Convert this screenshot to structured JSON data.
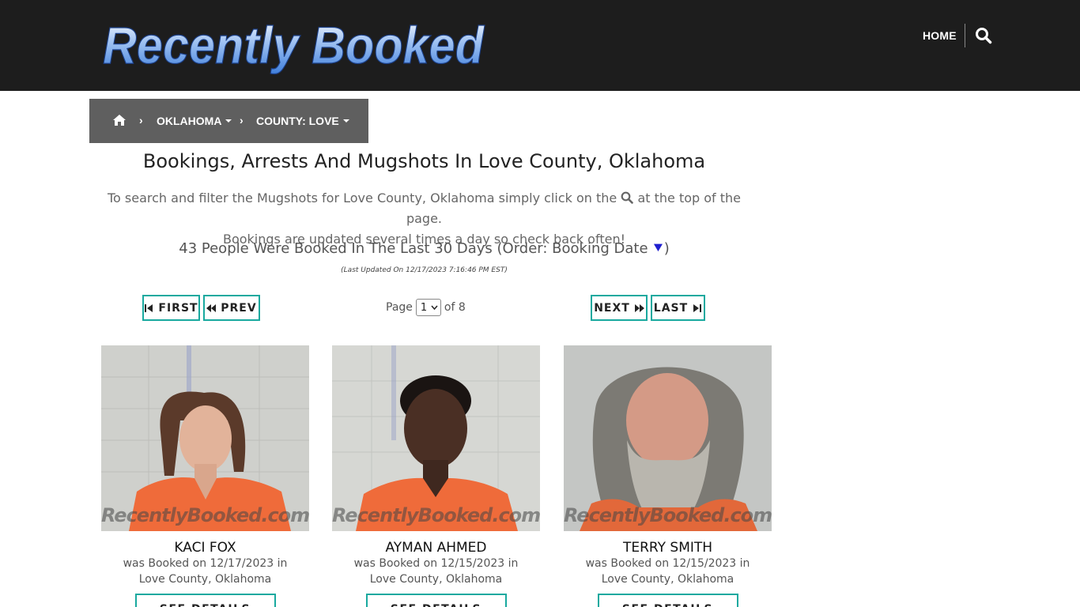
{
  "header": {
    "logo_text": "Recently Booked",
    "nav_home": "HOME",
    "search_icon": "search-icon"
  },
  "breadcrumb": {
    "home_icon": "home-icon",
    "sep_icon": "chevron-right-icon",
    "state": "OKLAHOMA",
    "county": "COUNTY: LOVE"
  },
  "main": {
    "title": "Bookings, Arrests And Mugshots In Love County, Oklahoma",
    "intro_before": "To search and filter the Mugshots for Love County, Oklahoma simply click on the",
    "intro_after": "at the top of the page.",
    "intro_line2": "Bookings are updated several times a day so check back often!",
    "count_text": "43 People Were Booked In The Last 30 Days (Order: Booking Date",
    "count_close": ")",
    "order_icon": "double-chevron-down-icon",
    "updated": "(Last Updated On 12/17/2023 7:16:46 PM EST)"
  },
  "pager": {
    "first": "FIRST",
    "prev": "PREV",
    "next": "NEXT",
    "last": "LAST",
    "page_label": "Page",
    "page_value": "1",
    "of_label": "of 8"
  },
  "colors": {
    "accent": "#19a99f",
    "header_bg": "#1d1d1d",
    "breadcrumb_bg": "#5f5f5f",
    "order_icon": "#1f1fcf"
  },
  "cards": [
    {
      "name": "KACI FOX",
      "line1": "was Booked on 12/17/2023 in",
      "line2": "Love County, Oklahoma",
      "button": "SEE DETAILS",
      "watermark": "RecentlyBooked.com"
    },
    {
      "name": "AYMAN AHMED",
      "line1": "was Booked on 12/15/2023 in",
      "line2": "Love County, Oklahoma",
      "button": "SEE DETAILS",
      "watermark": "RecentlyBooked.com"
    },
    {
      "name": "TERRY SMITH",
      "line1": "was Booked on 12/15/2023 in",
      "line2": "Love County, Oklahoma",
      "button": "SEE DETAILS",
      "watermark": "RecentlyBooked.com"
    }
  ]
}
